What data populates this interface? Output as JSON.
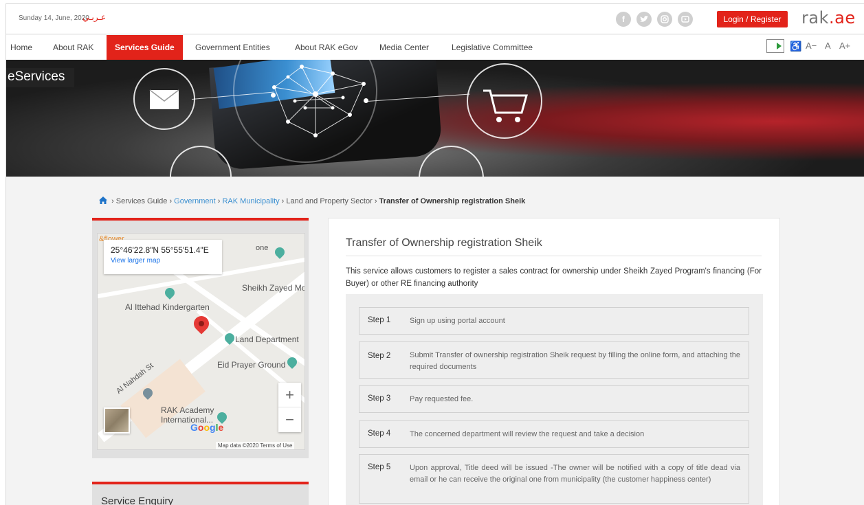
{
  "topbar": {
    "date": "Sunday 14, June, 2020",
    "arabic_link": "عـربـي",
    "social_icons": [
      "facebook-icon",
      "twitter-icon",
      "instagram-icon",
      "youtube-icon"
    ],
    "login_label": "Login / Register",
    "logo_text": "rak",
    "logo_suffix": ".ae"
  },
  "nav": {
    "items": [
      "Home",
      "About RAK",
      "Services Guide",
      "Government Entities",
      "About RAK eGov",
      "Media Center",
      "Legislative Committee"
    ],
    "active": "Services Guide",
    "tools": [
      "A−",
      "A",
      "A+"
    ]
  },
  "banner": {
    "title": "eServices"
  },
  "breadcrumb": {
    "items": [
      "Services Guide",
      "Government",
      "RAK Municipality",
      "Land and Property Sector",
      "Transfer of Ownership registration Sheik"
    ]
  },
  "map": {
    "coords": "25°46'22.8\"N 55°55'51.4\"E",
    "larger_link": "View larger map",
    "labels": [
      "&flower",
      "Al Ittehad Kindergarten",
      "Sheikh Zayed Mo",
      "Land Department",
      "Eid Prayer Ground",
      "Al Nahdah St",
      "RAK Academy",
      "International...",
      "one"
    ],
    "google": "Google",
    "footer": "Map data ©2020   Terms of Use",
    "zoom_in": "+",
    "zoom_out": "−"
  },
  "service_enquiry": "Service Enquiry",
  "service": {
    "title": "Transfer of Ownership registration Sheik",
    "description": "This service allows customers to register a sales contract for ownership under Sheikh Zayed Program's financing (For Buyer) or other RE financing authority",
    "steps": [
      {
        "label": "Step 1",
        "text": "Sign up using portal account"
      },
      {
        "label": "Step 2",
        "text": "Submit Transfer of ownership registration Sheik request by filling the online form, and attaching the required documents"
      },
      {
        "label": "Step 3",
        "text": "Pay requested fee."
      },
      {
        "label": "Step 4",
        "text": "The concerned department will review the request and take a decision"
      },
      {
        "label": "Step 5",
        "text": "Upon approval, Title deed will be issued -The owner will be notified with a copy of title dead via email or he can receive the original one from municipality (the customer happiness center)"
      }
    ]
  },
  "colors": {
    "accent": "#e2231a",
    "link": "#3a8fd0"
  }
}
